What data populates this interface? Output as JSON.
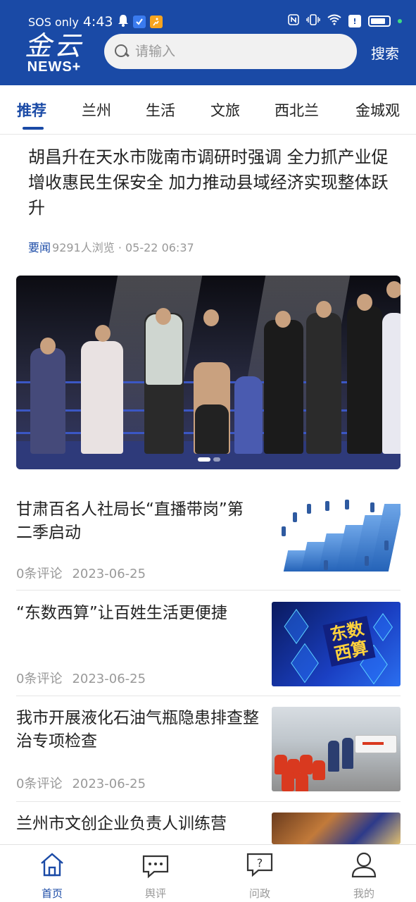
{
  "status_bar": {
    "carrier": "SOS only",
    "time": "4:43",
    "indicator": "!"
  },
  "header": {
    "logo_cn": "金云",
    "logo_en": "NEWS+",
    "search_placeholder": "请输入",
    "search_button": "搜索"
  },
  "tabs": [
    {
      "label": "推荐",
      "active": true
    },
    {
      "label": "兰州"
    },
    {
      "label": "生活"
    },
    {
      "label": "文旅"
    },
    {
      "label": "西北兰"
    },
    {
      "label": "金城观"
    }
  ],
  "top_story": {
    "title": "胡昌升在天水市陇南市调研时强调 全力抓产业促增收惠民生保安全 加力推动县域经济实现整体跃升",
    "tag": "要闻",
    "meta": "9291人浏览 · 05-22 06:37"
  },
  "banner": {
    "icon": "boxing-photo",
    "active_dot": 0,
    "dots": 2
  },
  "articles": [
    {
      "title": "甘肃百名人社局长“直播带岗”第二季启动",
      "comments": "0条评论",
      "date": "2023-06-25",
      "thumb": "chart-people"
    },
    {
      "title": "“东数西算”让百姓生活更便捷",
      "comments": "0条评论",
      "date": "2023-06-25",
      "thumb": "data-center",
      "thumb_text": "东数西算"
    },
    {
      "title": "我市开展液化石油气瓶隐患排查整治专项检查",
      "comments": "0条评论",
      "date": "2023-06-25",
      "thumb": "gas-cylinders"
    },
    {
      "title": "兰州市文创企业负责人训练营",
      "thumb": "art-craft"
    }
  ],
  "bottom_nav": [
    {
      "label": "首页",
      "icon": "home-icon",
      "active": true
    },
    {
      "label": "舆评",
      "icon": "chat-icon"
    },
    {
      "label": "问政",
      "icon": "question-icon"
    },
    {
      "label": "我的",
      "icon": "user-icon"
    }
  ],
  "colors": {
    "brand": "#1a4aa6",
    "text": "#222222",
    "meta": "#999999"
  }
}
